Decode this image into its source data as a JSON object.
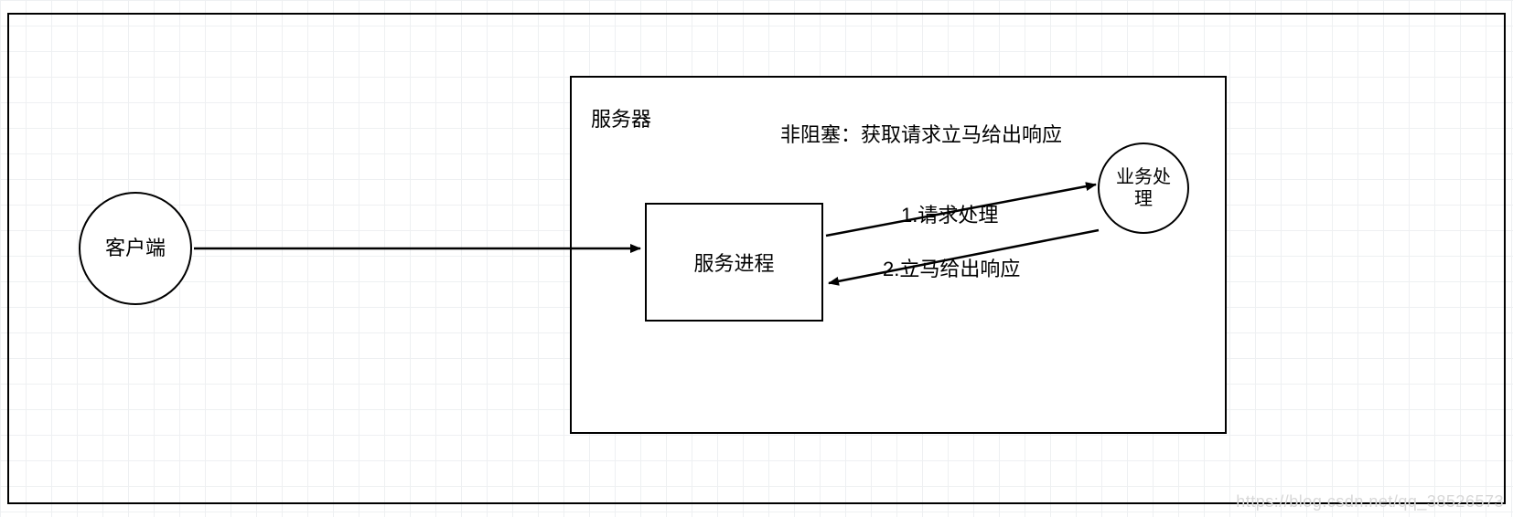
{
  "diagram": {
    "client_label": "客户端",
    "server_label": "服务器",
    "service_process_label": "服务进程",
    "business_process_label_line1": "业务处",
    "business_process_label_line2": "理",
    "nonblocking_note": "非阻塞：获取请求立马给出响应",
    "arrow1_label": "1.请求处理",
    "arrow2_label": "2.立马给出响应",
    "watermark": "https://blog.csdn.net/qq_38526573"
  }
}
